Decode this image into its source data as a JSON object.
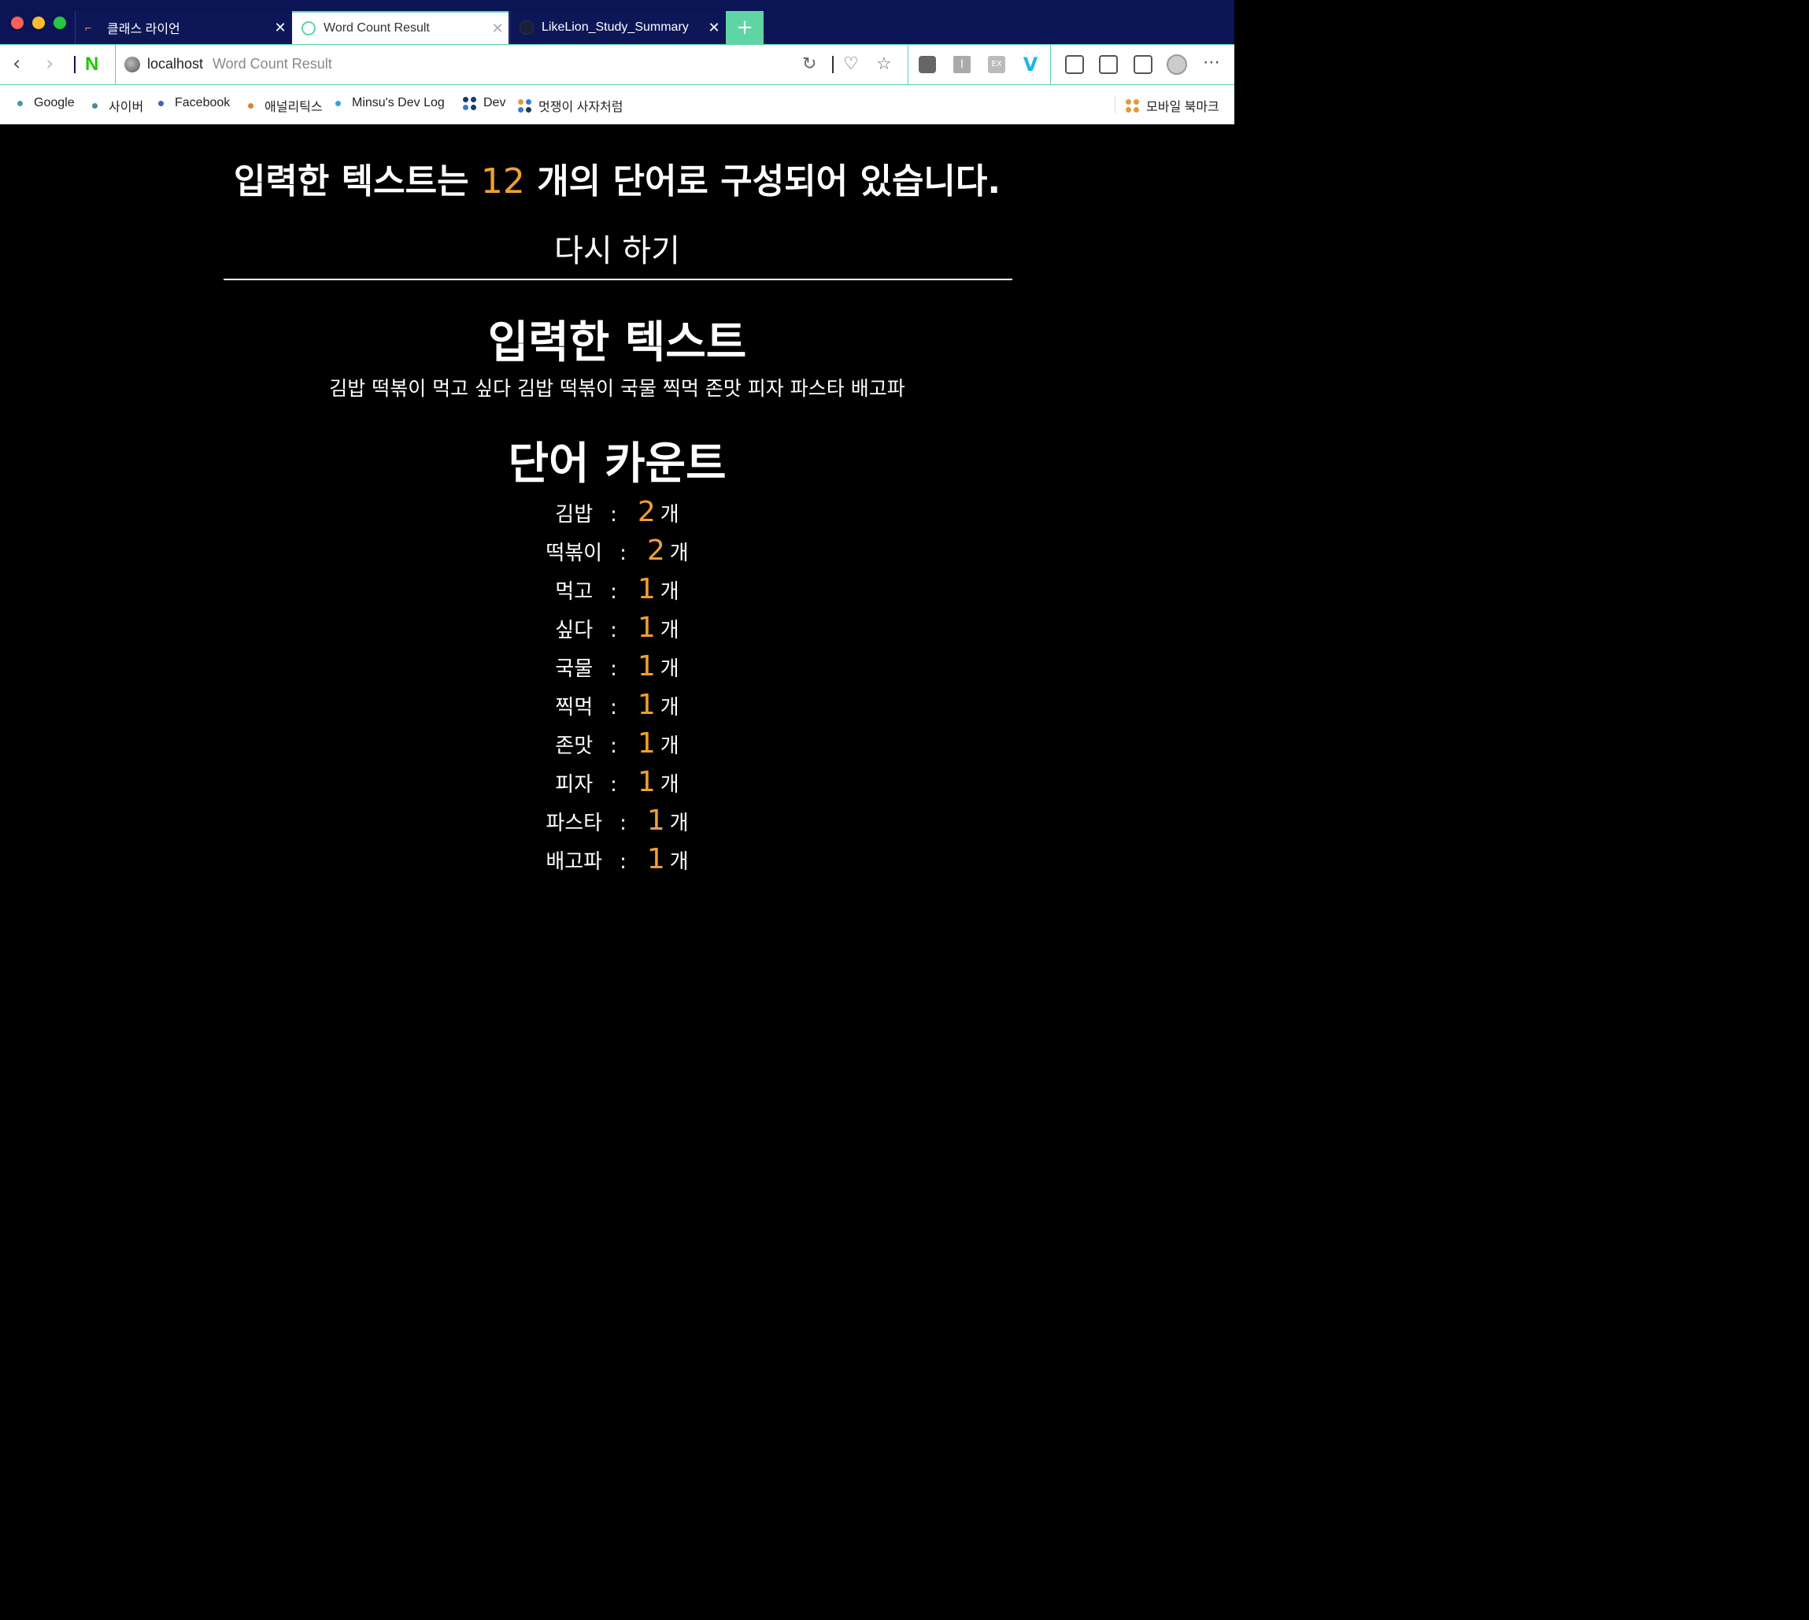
{
  "tabs": [
    {
      "title": "클래스 라이언",
      "close": "✕"
    },
    {
      "title": "Word Count Result",
      "close": "✕"
    },
    {
      "title": "LikeLion_Study_Summary",
      "close": "✕"
    }
  ],
  "new_tab": "+",
  "address": {
    "host": "localhost",
    "page_title": "Word Count Result"
  },
  "bookmarks": [
    {
      "label": "Google",
      "color": "#4a9aa0"
    },
    {
      "label": "사이버",
      "color": "#4a8aa0"
    },
    {
      "label": "Facebook",
      "color": "#4a60b0"
    },
    {
      "label": "애널리틱스",
      "color": "#e08030"
    },
    {
      "label": "Minsu's Dev Log",
      "color": "#3aa0e0"
    },
    {
      "label": "Dev",
      "color": "#1a3a6a"
    },
    {
      "label": "멋쟁이 사자처럼",
      "color": "#e09a40"
    },
    {
      "label": "모바일 북마크",
      "color": "#e09a40"
    }
  ],
  "result": {
    "headline_prefix": "입력한 텍스트는 ",
    "word_total": "12",
    "headline_suffix": " 개의 단어로 구성되어 있습니다.",
    "retry_label": "다시 하기"
  },
  "input_section": {
    "title": "입력한 텍스트",
    "text": "김밥 떡볶이 먹고 싶다 김밥 떡볶이 국물 찍먹 존맛 피자 파스타 배고파"
  },
  "count_section": {
    "title": "단어 카운트",
    "colon": ":",
    "unit": "개",
    "rows": [
      {
        "word": "김밥",
        "count": "2"
      },
      {
        "word": "떡볶이",
        "count": "2"
      },
      {
        "word": "먹고",
        "count": "1"
      },
      {
        "word": "싶다",
        "count": "1"
      },
      {
        "word": "국물",
        "count": "1"
      },
      {
        "word": "찍먹",
        "count": "1"
      },
      {
        "word": "존맛",
        "count": "1"
      },
      {
        "word": "피자",
        "count": "1"
      },
      {
        "word": "파스타",
        "count": "1"
      },
      {
        "word": "배고파",
        "count": "1"
      }
    ]
  },
  "colors": {
    "accent": "#f0a030",
    "tab_accent": "#5fd4a5",
    "tabstrip": "#0b1454"
  }
}
